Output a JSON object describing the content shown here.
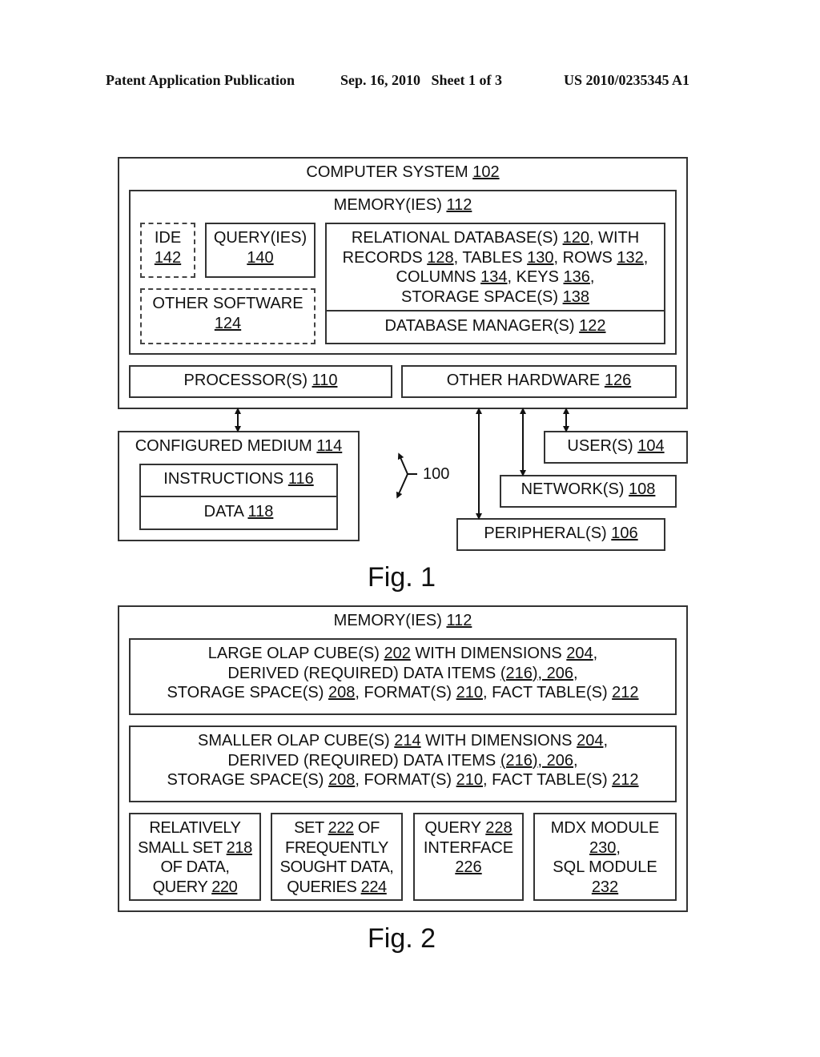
{
  "header": {
    "publication": "Patent Application Publication",
    "date_sheet": "Sep. 16, 2010   Sheet 1 of 3",
    "number": "US 2010/0235345 A1"
  },
  "fig1": {
    "caption": "Fig. 1",
    "computer_system": {
      "label": "COMPUTER SYSTEM ",
      "ref": "102"
    },
    "memories": {
      "label": "MEMORY(IES) ",
      "ref": "112"
    },
    "ide": {
      "label": "IDE",
      "ref": "142"
    },
    "queries": {
      "label": "QUERY(IES)",
      "ref": "140"
    },
    "other_software": {
      "label": "OTHER SOFTWARE",
      "ref": "124"
    },
    "relational_db": {
      "l1a": "RELATIONAL DATABASE(S) ",
      "r120": "120",
      "l1b": ", WITH",
      "l2a": "RECORDS ",
      "r128": "128",
      "l2b": ", TABLES ",
      "r130": "130",
      "l2c": ", ROWS ",
      "r132": "132",
      "l2d": ",",
      "l3a": "COLUMNS ",
      "r134": "134",
      "l3b": ", KEYS ",
      "r136": "136",
      "l3c": ",",
      "l4a": "STORAGE SPACE(S) ",
      "r138": "138"
    },
    "db_manager": {
      "label": "DATABASE MANAGER(S) ",
      "ref": "122"
    },
    "processors": {
      "label": "PROCESSOR(S) ",
      "ref": "110"
    },
    "other_hardware": {
      "label": "OTHER HARDWARE ",
      "ref": "126"
    },
    "configured_medium": {
      "label": "CONFIGURED MEDIUM ",
      "ref": "114"
    },
    "instructions": {
      "label": "INSTRUCTIONS ",
      "ref": "116"
    },
    "data": {
      "label": "DATA ",
      "ref": "118"
    },
    "system_ref": "100",
    "users": {
      "label": "USER(S) ",
      "ref": "104"
    },
    "networks": {
      "label": "NETWORK(S) ",
      "ref": "108"
    },
    "peripherals": {
      "label": "PERIPHERAL(S) ",
      "ref": "106"
    }
  },
  "fig2": {
    "caption": "Fig. 2",
    "memories": {
      "label": "MEMORY(IES) ",
      "ref": "112"
    },
    "large_cube": {
      "l1a": "LARGE OLAP CUBE(S) ",
      "r202": "202",
      "l1b": " WITH DIMENSIONS ",
      "r204": "204",
      "l1c": ",",
      "l2a": "DERIVED (REQUIRED) DATA ITEMS ",
      "r216_206": "(216), 206",
      "l2b": ",",
      "l3a": "STORAGE SPACE(S) ",
      "r208": "208",
      "l3b": ", FORMAT(S) ",
      "r210": "210",
      "l3c": ", FACT TABLE(S) ",
      "r212": "212"
    },
    "smaller_cube": {
      "l1a": "SMALLER OLAP CUBE(S) ",
      "r214": "214",
      "l1b": " WITH DIMENSIONS ",
      "r204": "204",
      "l1c": ",",
      "l2a": "DERIVED (REQUIRED) DATA ITEMS ",
      "r216_206": "(216), 206",
      "l2b": ",",
      "l3a": "STORAGE SPACE(S) ",
      "r208": "208",
      "l3b": ", FORMAT(S) ",
      "r210": "210",
      "l3c": ", FACT TABLE(S) ",
      "r212": "212"
    },
    "small_set": {
      "l1": "RELATIVELY",
      "l2a": "SMALL SET ",
      "r218": "218",
      "l3": "OF DATA,",
      "l4a": "QUERY ",
      "r220": "220"
    },
    "set_222": {
      "l1a": "SET ",
      "r222": "222",
      "l1b": " OF",
      "l2": "FREQUENTLY",
      "l3": "SOUGHT DATA,",
      "l4a": "QUERIES ",
      "r224": "224"
    },
    "query_interface": {
      "l1a": "QUERY ",
      "r228": "228",
      "l2": "INTERFACE",
      "r226": "226"
    },
    "modules": {
      "l1": "MDX MODULE",
      "r230": "230",
      "l2b": ",",
      "l3": "SQL MODULE",
      "r232": "232"
    }
  }
}
